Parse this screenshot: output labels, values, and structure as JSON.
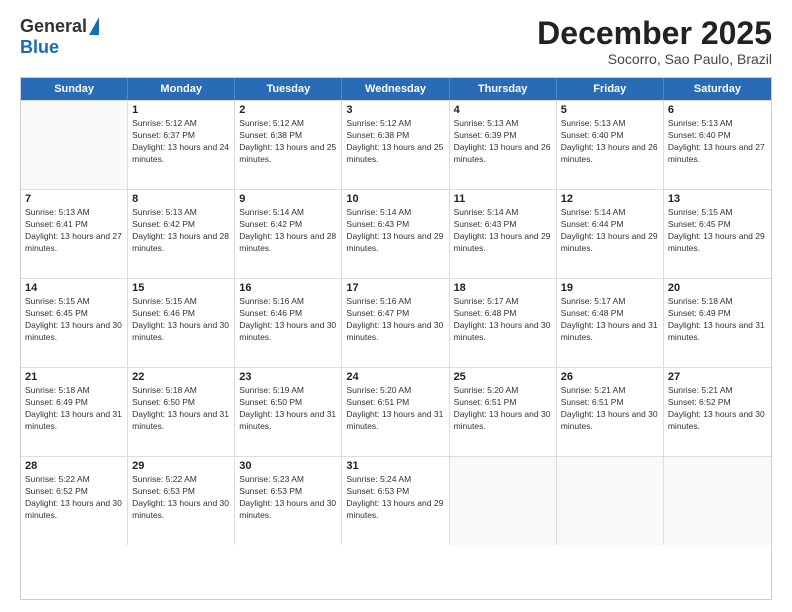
{
  "header": {
    "logo_general": "General",
    "logo_blue": "Blue",
    "month_title": "December 2025",
    "location": "Socorro, Sao Paulo, Brazil"
  },
  "days": [
    "Sunday",
    "Monday",
    "Tuesday",
    "Wednesday",
    "Thursday",
    "Friday",
    "Saturday"
  ],
  "weeks": [
    [
      {
        "num": "",
        "empty": true
      },
      {
        "num": "1",
        "sunrise": "5:12 AM",
        "sunset": "6:37 PM",
        "daylight": "13 hours and 24 minutes."
      },
      {
        "num": "2",
        "sunrise": "5:12 AM",
        "sunset": "6:38 PM",
        "daylight": "13 hours and 25 minutes."
      },
      {
        "num": "3",
        "sunrise": "5:12 AM",
        "sunset": "6:38 PM",
        "daylight": "13 hours and 25 minutes."
      },
      {
        "num": "4",
        "sunrise": "5:13 AM",
        "sunset": "6:39 PM",
        "daylight": "13 hours and 26 minutes."
      },
      {
        "num": "5",
        "sunrise": "5:13 AM",
        "sunset": "6:40 PM",
        "daylight": "13 hours and 26 minutes."
      },
      {
        "num": "6",
        "sunrise": "5:13 AM",
        "sunset": "6:40 PM",
        "daylight": "13 hours and 27 minutes."
      }
    ],
    [
      {
        "num": "7",
        "sunrise": "5:13 AM",
        "sunset": "6:41 PM",
        "daylight": "13 hours and 27 minutes."
      },
      {
        "num": "8",
        "sunrise": "5:13 AM",
        "sunset": "6:42 PM",
        "daylight": "13 hours and 28 minutes."
      },
      {
        "num": "9",
        "sunrise": "5:14 AM",
        "sunset": "6:42 PM",
        "daylight": "13 hours and 28 minutes."
      },
      {
        "num": "10",
        "sunrise": "5:14 AM",
        "sunset": "6:43 PM",
        "daylight": "13 hours and 29 minutes."
      },
      {
        "num": "11",
        "sunrise": "5:14 AM",
        "sunset": "6:43 PM",
        "daylight": "13 hours and 29 minutes."
      },
      {
        "num": "12",
        "sunrise": "5:14 AM",
        "sunset": "6:44 PM",
        "daylight": "13 hours and 29 minutes."
      },
      {
        "num": "13",
        "sunrise": "5:15 AM",
        "sunset": "6:45 PM",
        "daylight": "13 hours and 29 minutes."
      }
    ],
    [
      {
        "num": "14",
        "sunrise": "5:15 AM",
        "sunset": "6:45 PM",
        "daylight": "13 hours and 30 minutes."
      },
      {
        "num": "15",
        "sunrise": "5:15 AM",
        "sunset": "6:46 PM",
        "daylight": "13 hours and 30 minutes."
      },
      {
        "num": "16",
        "sunrise": "5:16 AM",
        "sunset": "6:46 PM",
        "daylight": "13 hours and 30 minutes."
      },
      {
        "num": "17",
        "sunrise": "5:16 AM",
        "sunset": "6:47 PM",
        "daylight": "13 hours and 30 minutes."
      },
      {
        "num": "18",
        "sunrise": "5:17 AM",
        "sunset": "6:48 PM",
        "daylight": "13 hours and 30 minutes."
      },
      {
        "num": "19",
        "sunrise": "5:17 AM",
        "sunset": "6:48 PM",
        "daylight": "13 hours and 31 minutes."
      },
      {
        "num": "20",
        "sunrise": "5:18 AM",
        "sunset": "6:49 PM",
        "daylight": "13 hours and 31 minutes."
      }
    ],
    [
      {
        "num": "21",
        "sunrise": "5:18 AM",
        "sunset": "6:49 PM",
        "daylight": "13 hours and 31 minutes."
      },
      {
        "num": "22",
        "sunrise": "5:18 AM",
        "sunset": "6:50 PM",
        "daylight": "13 hours and 31 minutes."
      },
      {
        "num": "23",
        "sunrise": "5:19 AM",
        "sunset": "6:50 PM",
        "daylight": "13 hours and 31 minutes."
      },
      {
        "num": "24",
        "sunrise": "5:20 AM",
        "sunset": "6:51 PM",
        "daylight": "13 hours and 31 minutes."
      },
      {
        "num": "25",
        "sunrise": "5:20 AM",
        "sunset": "6:51 PM",
        "daylight": "13 hours and 30 minutes."
      },
      {
        "num": "26",
        "sunrise": "5:21 AM",
        "sunset": "6:51 PM",
        "daylight": "13 hours and 30 minutes."
      },
      {
        "num": "27",
        "sunrise": "5:21 AM",
        "sunset": "6:52 PM",
        "daylight": "13 hours and 30 minutes."
      }
    ],
    [
      {
        "num": "28",
        "sunrise": "5:22 AM",
        "sunset": "6:52 PM",
        "daylight": "13 hours and 30 minutes."
      },
      {
        "num": "29",
        "sunrise": "5:22 AM",
        "sunset": "6:53 PM",
        "daylight": "13 hours and 30 minutes."
      },
      {
        "num": "30",
        "sunrise": "5:23 AM",
        "sunset": "6:53 PM",
        "daylight": "13 hours and 30 minutes."
      },
      {
        "num": "31",
        "sunrise": "5:24 AM",
        "sunset": "6:53 PM",
        "daylight": "13 hours and 29 minutes."
      },
      {
        "num": "",
        "empty": true
      },
      {
        "num": "",
        "empty": true
      },
      {
        "num": "",
        "empty": true
      }
    ]
  ]
}
